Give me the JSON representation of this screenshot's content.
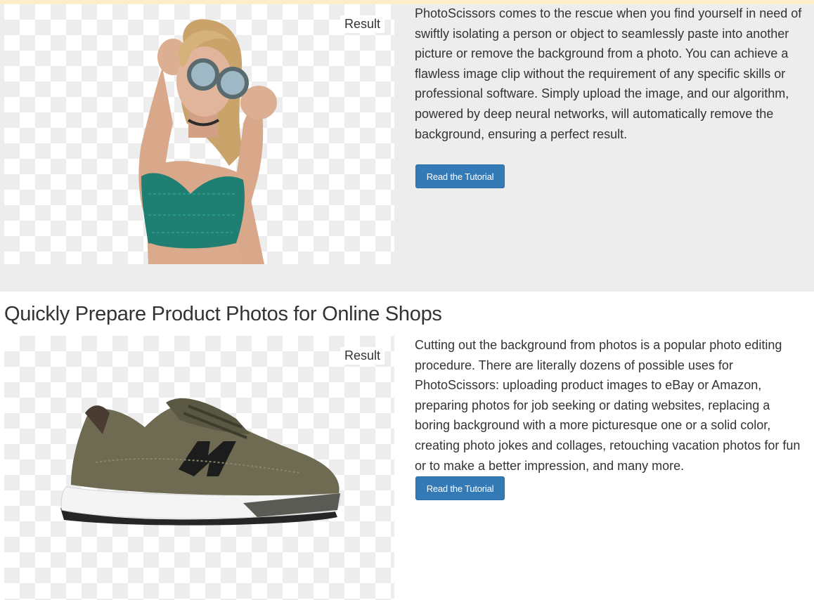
{
  "section_1": {
    "result_label": "Result",
    "description": "PhotoScissors comes to the rescue when you find yourself in need of swiftly isolating a person or object to seamlessly paste into another picture or remove the background from a photo. You can achieve a flawless image clip without the requirement of any specific skills or professional software. Simply upload the image, and our algorithm, powered by deep neural networks, will automatically remove the background, ensuring a perfect result.",
    "button_label": "Read the Tutorial"
  },
  "section_2": {
    "heading": "Quickly Prepare Product Photos for Online Shops",
    "result_label": "Result",
    "description": "Cutting out the background from photos is a popular photo editing procedure. There are literally dozens of possible uses for PhotoScissors: uploading product images to eBay or Amazon, preparing photos for job seeking or dating websites, replacing a boring background with a more picturesque one or a solid color, creating photo jokes and collages, retouching vacation photos for fun or to make a better impression, and many more.",
    "button_label": "Read the Tutorial"
  },
  "colors": {
    "top_strip": "#fcefc7",
    "section_background": "#ededed",
    "button_primary": "#337ab7",
    "checker_light": "#ffffff",
    "checker_dark": "#ededed"
  }
}
